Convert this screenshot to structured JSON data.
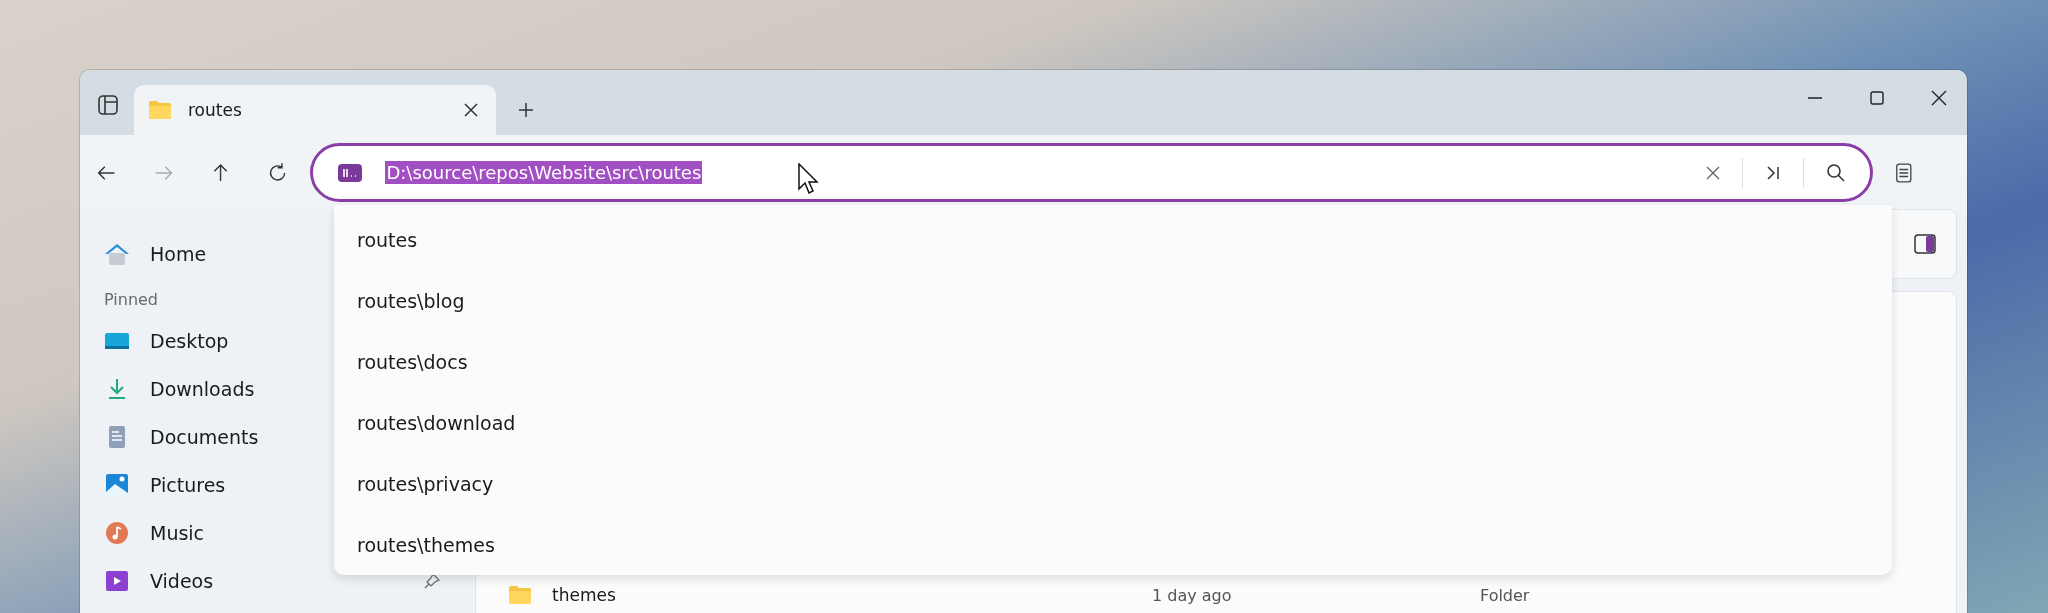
{
  "tabs": [
    {
      "label": "routes",
      "selected": true
    }
  ],
  "address_bar": {
    "value": "D:\\source\\repos\\Website\\src\\routes",
    "text_selected": true
  },
  "suggestions": [
    {
      "label": "routes"
    },
    {
      "label": "routes\\blog"
    },
    {
      "label": "routes\\docs"
    },
    {
      "label": "routes\\download"
    },
    {
      "label": "routes\\privacy"
    },
    {
      "label": "routes\\themes"
    }
  ],
  "sidebar": {
    "home": {
      "label": "Home",
      "kind": "home"
    },
    "section": "Pinned",
    "items": [
      {
        "label": "Desktop",
        "kind": "desktop"
      },
      {
        "label": "Downloads",
        "kind": "downloads"
      },
      {
        "label": "Documents",
        "kind": "documents"
      },
      {
        "label": "Pictures",
        "kind": "pictures"
      },
      {
        "label": "Music",
        "kind": "music"
      },
      {
        "label": "Videos",
        "kind": "videos",
        "show_pin": true
      }
    ]
  },
  "file_list": {
    "rows": [
      {
        "name": "themes",
        "modified": "1 day ago",
        "type": "Folder"
      }
    ]
  }
}
